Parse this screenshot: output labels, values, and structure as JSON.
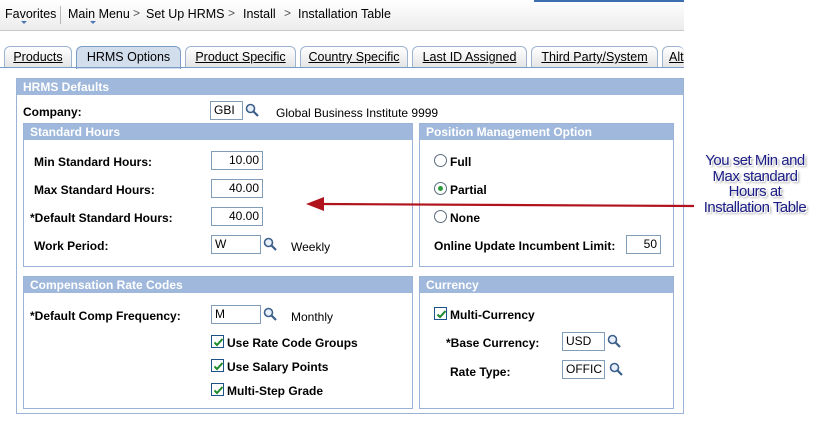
{
  "breadcrumb": {
    "favorites": "Favorites",
    "main_menu": "Main Menu",
    "set_up_hrms": "Set Up HRMS",
    "install": "Install",
    "installation_table": "Installation Table"
  },
  "tabs": [
    {
      "label": "Products",
      "active": false
    },
    {
      "label": "HRMS Options",
      "active": true
    },
    {
      "label": "Product Specific",
      "active": false
    },
    {
      "label": "Country Specific",
      "active": false
    },
    {
      "label": "Last ID Assigned",
      "active": false
    },
    {
      "label": "Third Party/System",
      "active": false
    },
    {
      "label": "Alt",
      "active": false
    }
  ],
  "hrms_defaults": {
    "title": "HRMS Defaults",
    "company_label": "Company:",
    "company_value": "GBI",
    "company_desc": "Global Business Institute 9999"
  },
  "standard_hours": {
    "title": "Standard Hours",
    "min_label": "Min Standard Hours:",
    "min_value": "10.00",
    "max_label": "Max Standard Hours:",
    "max_value": "40.00",
    "default_label": "*Default Standard Hours:",
    "default_value": "40.00",
    "work_period_label": "Work Period:",
    "work_period_value": "W",
    "work_period_desc": "Weekly"
  },
  "position_management": {
    "title": "Position Management Option",
    "options": [
      {
        "label": "Full",
        "selected": false
      },
      {
        "label": "Partial",
        "selected": true
      },
      {
        "label": "None",
        "selected": false
      }
    ],
    "online_update_label": "Online Update Incumbent Limit:",
    "online_update_value": "50"
  },
  "compensation": {
    "title": "Compensation Rate Codes",
    "default_freq_label": "*Default Comp Frequency:",
    "default_freq_value": "M",
    "default_freq_desc": "Monthly",
    "checkboxes": [
      {
        "label": "Use Rate Code Groups",
        "checked": true
      },
      {
        "label": "Use Salary Points",
        "checked": true
      },
      {
        "label": "Multi-Step Grade",
        "checked": true
      }
    ]
  },
  "currency": {
    "title": "Currency",
    "multi_currency_label": "Multi-Currency",
    "multi_currency_checked": true,
    "base_currency_label": "*Base Currency:",
    "base_currency_value": "USD",
    "rate_type_label": "Rate Type:",
    "rate_type_value": "OFFIC"
  },
  "annotation": {
    "line1": "You set Min and",
    "line2": "Max standard",
    "line3": "Hours at",
    "line4": "Installation Table",
    "arrow_color": "#b0131c",
    "text_color": "#1c1d86"
  },
  "colors": {
    "group_header": "#9fb8db",
    "active_tab": "#d3deed",
    "border": "#9bb3d6"
  }
}
